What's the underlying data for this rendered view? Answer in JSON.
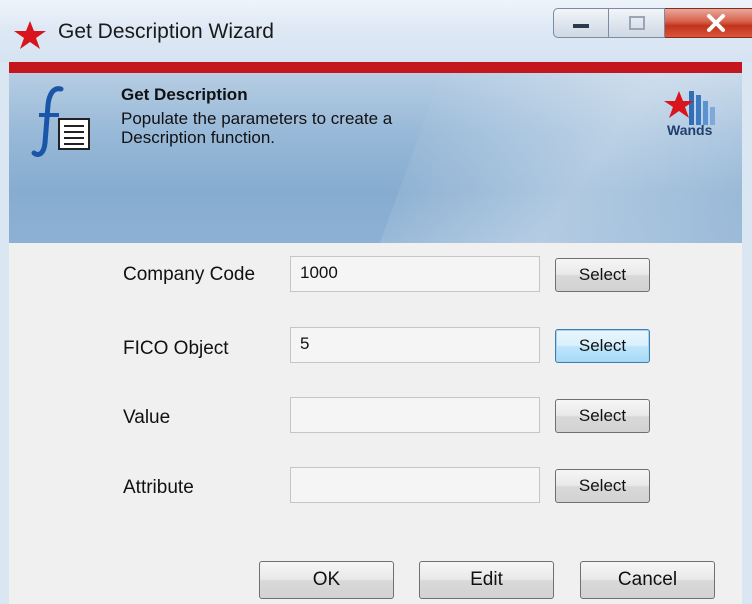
{
  "window": {
    "title": "Get Description Wizard",
    "icons": [
      "wands-star-icon",
      "minimize-icon",
      "maximize-icon",
      "close-icon"
    ]
  },
  "header": {
    "title": "Get Description",
    "description": "Populate the parameters to create a Description function.",
    "logo_text": "Wands",
    "accent_color": "#c4171d"
  },
  "form": {
    "rows": [
      {
        "label": "Company Code",
        "value": "1000",
        "button": "Select"
      },
      {
        "label": "FICO Object",
        "value": "5",
        "button": "Select"
      },
      {
        "label": "Value",
        "value": "",
        "button": "Select"
      },
      {
        "label": "Attribute",
        "value": "",
        "button": "Select"
      }
    ]
  },
  "footer": {
    "ok": "OK",
    "edit": "Edit",
    "cancel": "Cancel"
  }
}
